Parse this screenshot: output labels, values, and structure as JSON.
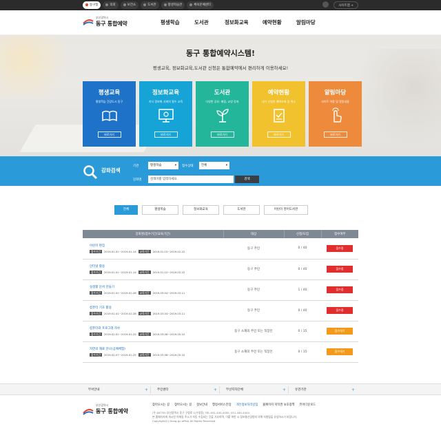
{
  "topbar": {
    "sites": [
      "동구청",
      "의회",
      "보건소",
      "도서관",
      "평생학습관",
      "체육문예센터"
    ],
    "sitemap": "사이트맵 +"
  },
  "logo": {
    "small": "부산광역시",
    "big": "동구 통합예약"
  },
  "nav": [
    "평생학습",
    "도서관",
    "정보화교육",
    "예약현황",
    "알림마당"
  ],
  "hero": {
    "title": "동구 통합예약시스템!",
    "subtitle": "평생교육, 정보화교육,도서관 신청은 통합예약에서 편리하게 이용하세요!"
  },
  "cards": [
    {
      "title": "평생교육",
      "desc": "평생학습 건강도시 동구",
      "go": "바로가기",
      "color": "#1e73c9",
      "icon": "book-icon"
    },
    {
      "title": "정보화교육",
      "desc": "지식 정보화 사회의 필수 교육",
      "go": "바로가기",
      "color": "#16a3d6",
      "icon": "monitor-icon"
    },
    {
      "title": "도서관",
      "desc": "다양한 공유, 배움, 교양 강좌",
      "go": "바로가기",
      "color": "#23b69a",
      "icon": "sprout-icon"
    },
    {
      "title": "예약현황",
      "desc": "내가 신청한 예약조회 및 취소",
      "go": "바로가기",
      "color": "#f2c12e",
      "icon": "clipboard-icon"
    },
    {
      "title": "알림마당",
      "desc": "사이트 이용 및 알림내용",
      "go": "바로가기",
      "color": "#ee8a3c",
      "icon": "pointer-icon"
    }
  ],
  "search": {
    "label": "강좌검색",
    "org_label": "기관",
    "org_value": "평생학습",
    "status_label": "접수상태",
    "status_value": "전체",
    "name_label": "강좌명",
    "name_placeholder": "검색어를 입력하세요.",
    "button": "검색"
  },
  "tabs": [
    "전체",
    "평생학습",
    "정보화교육",
    "도서관",
    "어린이 영어도서관"
  ],
  "table": {
    "headers": [
      "강좌명(접수기간/교육기간)",
      "대상",
      "신청/모집",
      "접수여부"
    ],
    "apply_tag": "접수기간",
    "edu_tag": "교육기간",
    "rows": [
      {
        "name": "어린이 편집",
        "apply": "2019.01.01~2019.01.14",
        "edu": "2019.01.15~2019.02.22",
        "target": "동구 주민",
        "count": "0 / 40",
        "status": "접수중",
        "state": "red"
      },
      {
        "name": "인터넷 활용",
        "apply": "2019.01.01~2019.01.14",
        "edu": "2019.01.10~2019.02.22",
        "target": "동구 주민",
        "count": "0 / 40",
        "status": "접수중",
        "state": "red"
      },
      {
        "name": "실생활 문서 만들기",
        "apply": "2019.01.01~2019.02.28",
        "edu": "2019.03.04~2019.03.11",
        "target": "동구 주민",
        "count": "1 / 40",
        "status": "접수중",
        "state": "red"
      },
      {
        "name": "컴퓨터 기초 활용",
        "apply": "2019.01.01~2019.02.28",
        "edu": "2019.03.04~2019.03.11",
        "target": "동구 주민",
        "count": "0 / 40",
        "status": "접수중",
        "state": "red"
      },
      {
        "name": "컴퓨터와 프로그래 자수",
        "apply": "2019.02.01~2019.02.25",
        "edu": "2019.03.08~2019.05.10",
        "target": "동구 소재의 주민 또는 직장인",
        "count": "0 / 15",
        "status": "접수대기",
        "state": "orange"
      },
      {
        "name": "자연의 재료 만나(공예체험)",
        "apply": "2019.02.07~2019.02.25",
        "edu": "2019.03.08~2019.05.10",
        "target": "동구 소재의 주민 또는 직장인",
        "count": "0 / 15",
        "status": "접수대기",
        "state": "orange"
      }
    ]
  },
  "footer": {
    "sections": [
      "부서안내",
      "주민센터",
      "부산지자단체",
      "유관기관"
    ],
    "links": [
      "찾아오시는 길",
      "찾아오시는 길",
      "정보안내",
      "행정서비스헌장",
      "개인정보처리방침",
      "홈페이지 저작권 보호정책",
      "뷰어다운로드"
    ],
    "info1": "(우 48735) 부산광역시 동구 구청로 1(수정동) TEL:051-440-4000, 051-440-4444",
    "info2": "본 홈페이지에 게시된 이메일 주소가 자동 수집되는 것을 거부하며, 이를 위반 시 정보통신망법에 의해 처벌됨을 유념하시기 바랍니다.",
    "copyright": "Copyright(C) Dong-gu office All Rights Reserved."
  }
}
